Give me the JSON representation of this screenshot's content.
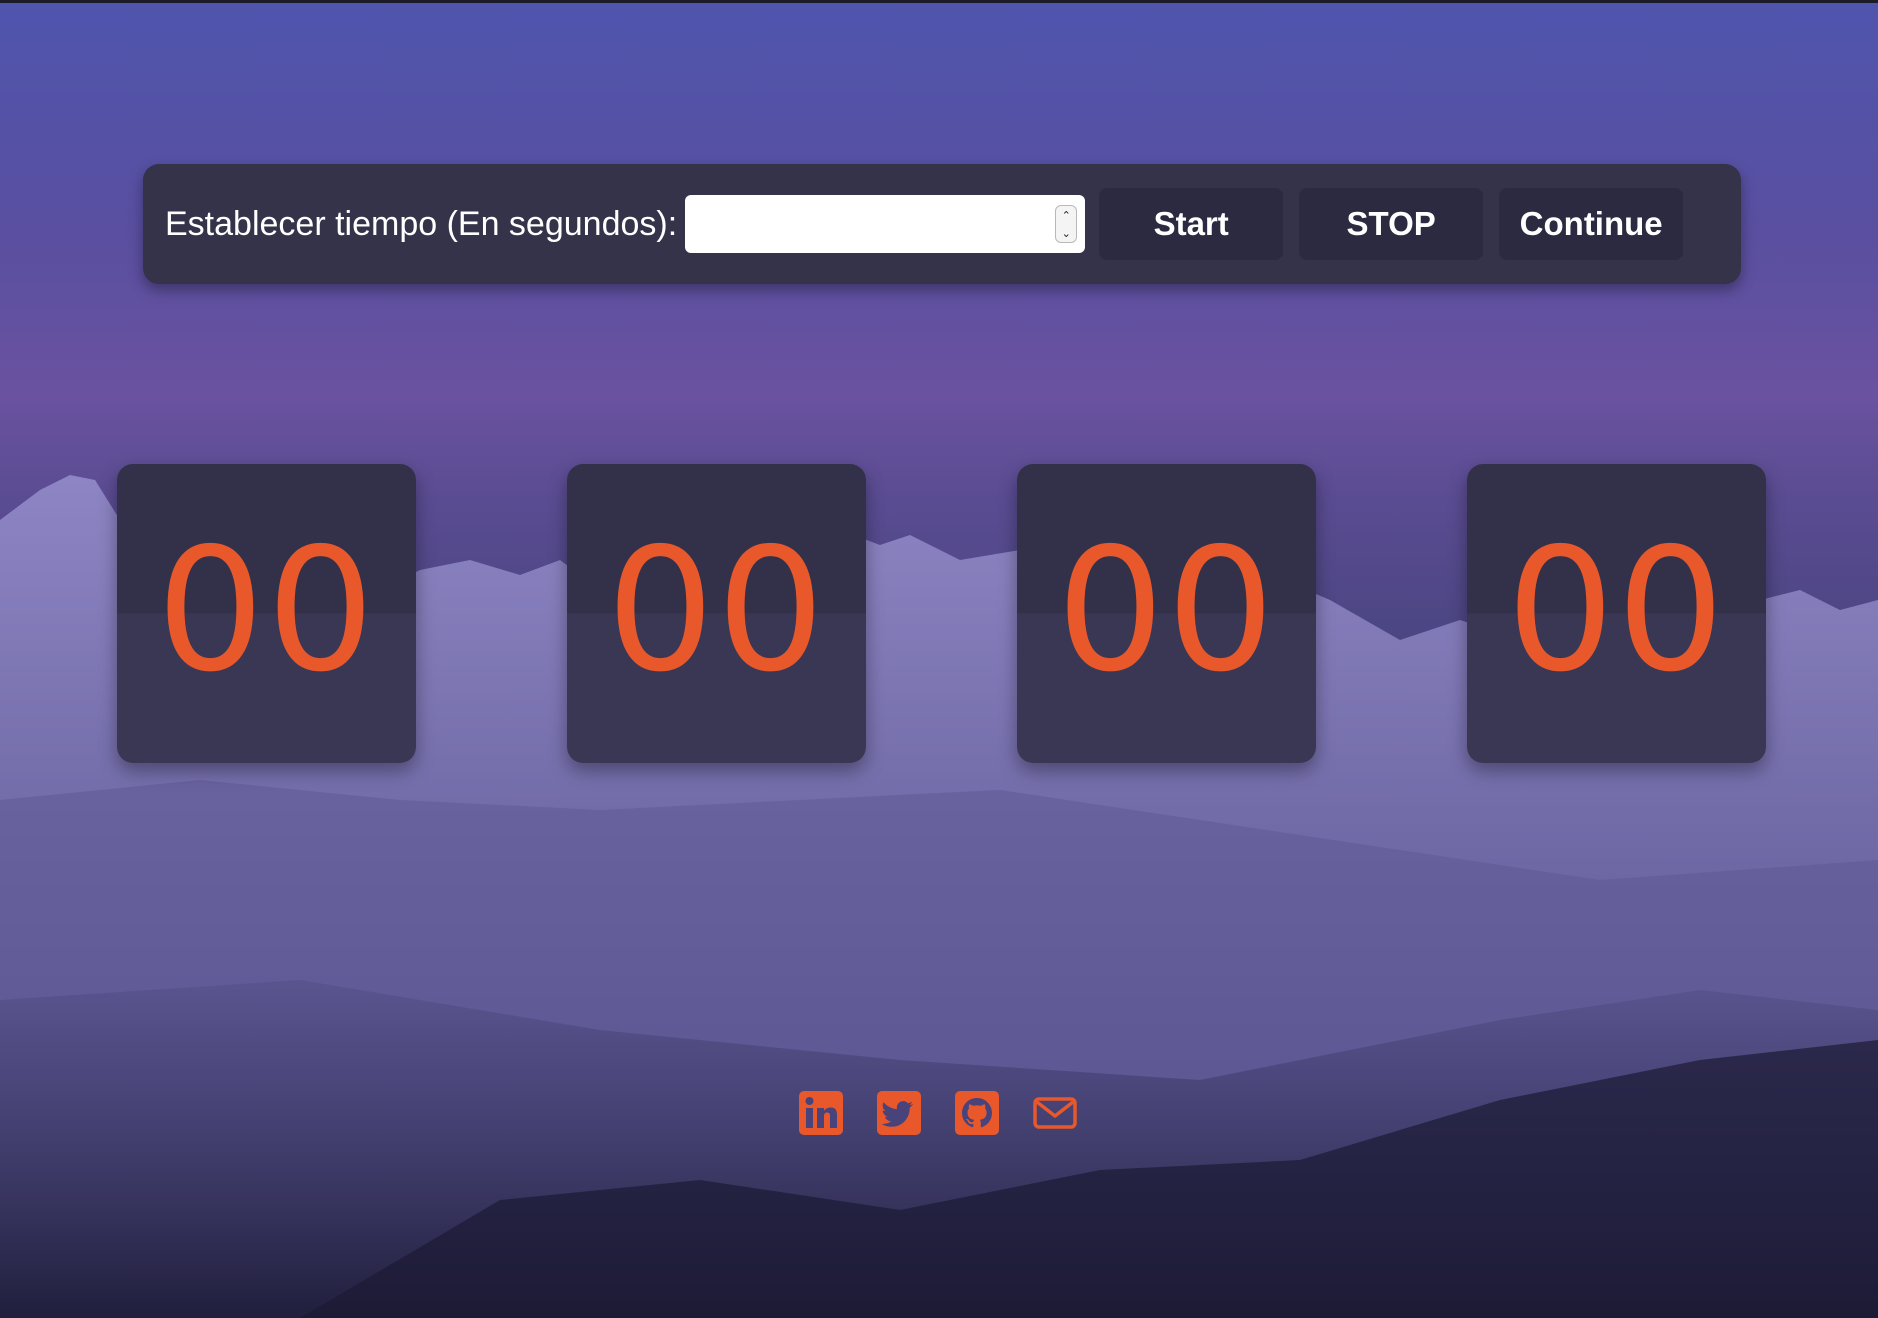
{
  "timer_form": {
    "label": "Establecer tiempo (En segundos):",
    "input_value": "",
    "input_placeholder": "",
    "start_label": "Start",
    "stop_label": "STOP",
    "continue_label": "Continue"
  },
  "countdown": [
    {
      "value": "00"
    },
    {
      "value": "00"
    },
    {
      "value": "00"
    },
    {
      "value": "00"
    }
  ],
  "social_links": [
    {
      "icon": "linkedin-icon"
    },
    {
      "icon": "twitter-icon"
    },
    {
      "icon": "github-icon"
    },
    {
      "icon": "email-icon"
    }
  ],
  "colors": {
    "accent": "#e8582b",
    "panel": "#34334a",
    "button": "#2b2a40",
    "card": "#33314a"
  }
}
